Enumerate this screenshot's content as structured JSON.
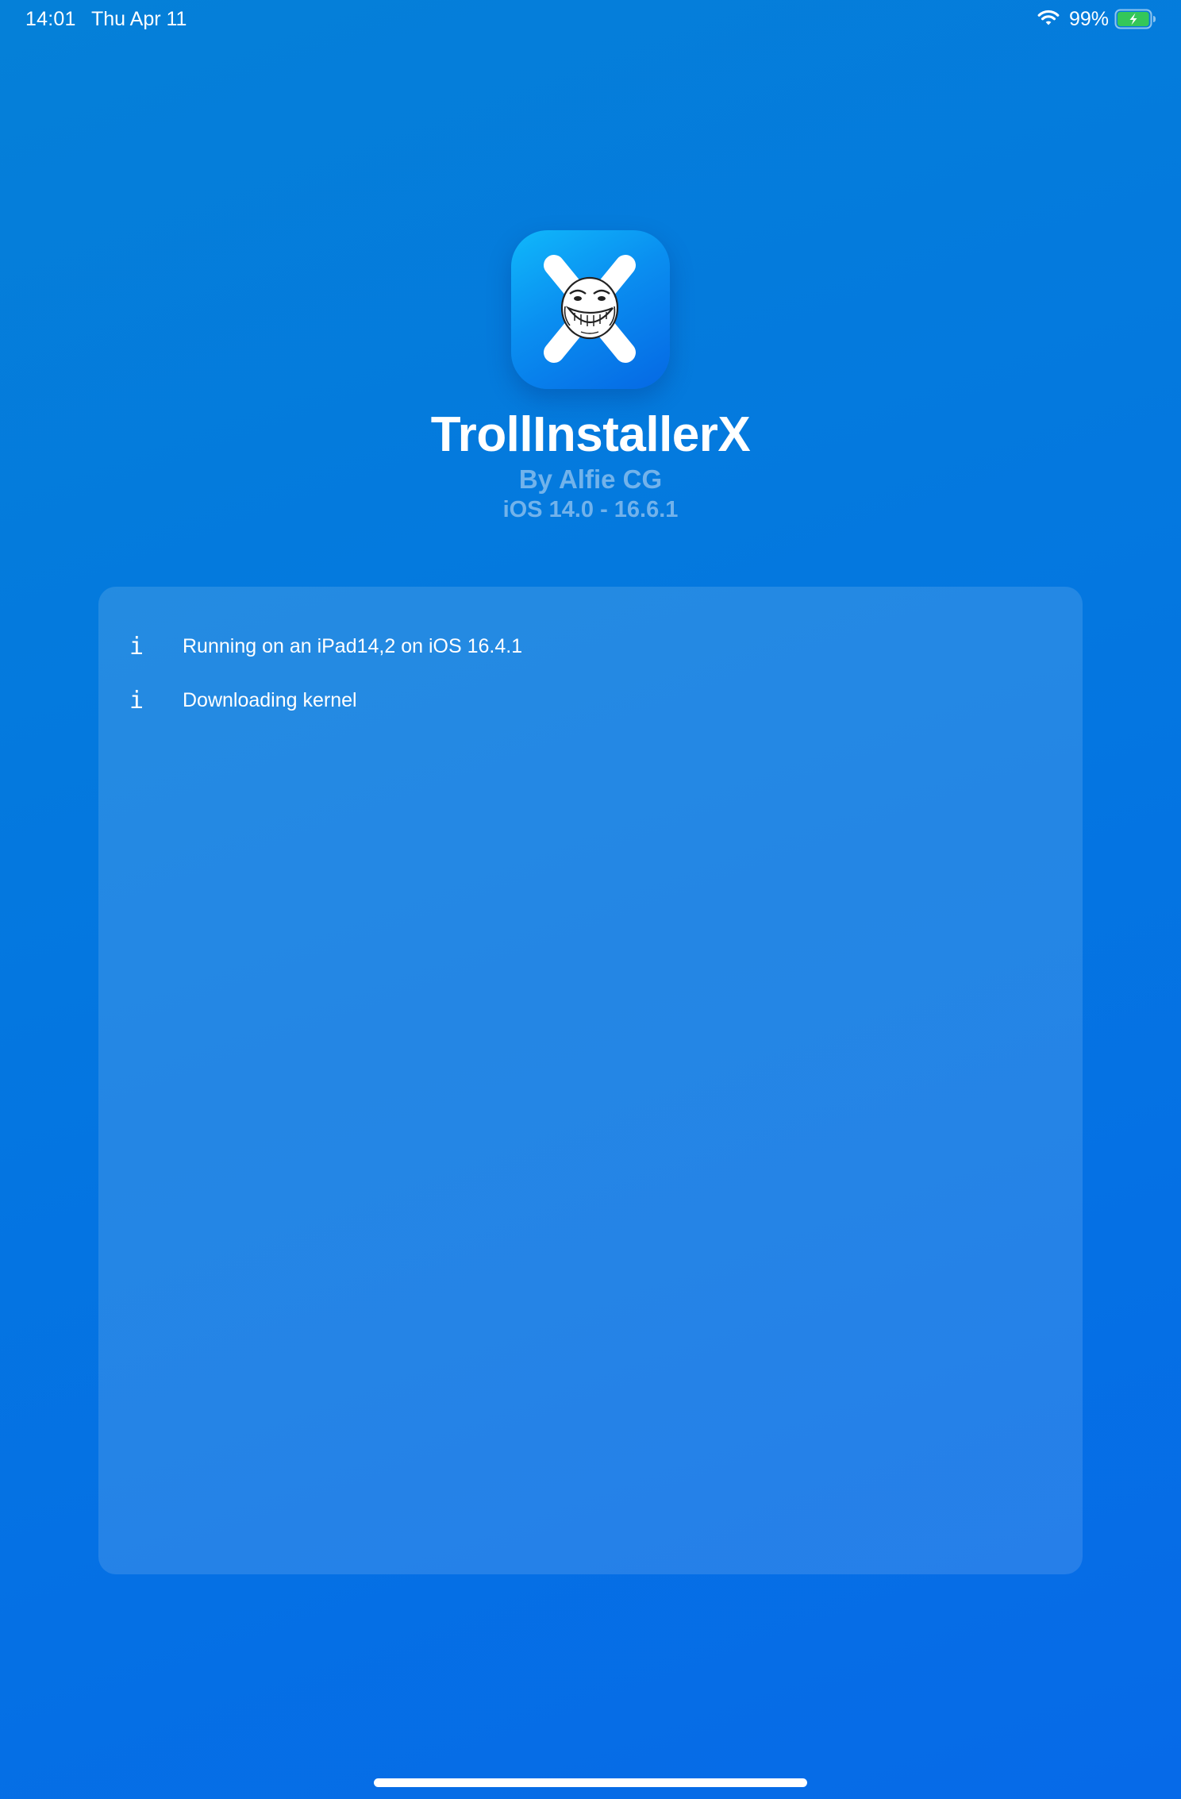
{
  "status_bar": {
    "time": "14:01",
    "date": "Thu Apr 11",
    "battery_percent": "99%",
    "battery_level": 0.99,
    "charging": true,
    "wifi_icon": "wifi-icon",
    "battery_icon": "battery-charging-icon"
  },
  "header": {
    "app_icon": "trollinstallerx-app-icon",
    "title": "TrollInstallerX",
    "author": "By Alfie CG",
    "supported_versions": "iOS 14.0 - 16.6.1"
  },
  "log": {
    "entries": [
      {
        "icon": "info-icon",
        "symbol": "i",
        "text": "Running on an iPad14,2 on iOS 16.4.1"
      },
      {
        "icon": "info-icon",
        "symbol": "i",
        "text": "Downloading kernel"
      }
    ]
  },
  "colors": {
    "background_top": "#0580d8",
    "background_bottom": "#066ae8",
    "text": "#ffffff",
    "subtitle": "#cde1f5",
    "battery_fill": "#34c759"
  }
}
